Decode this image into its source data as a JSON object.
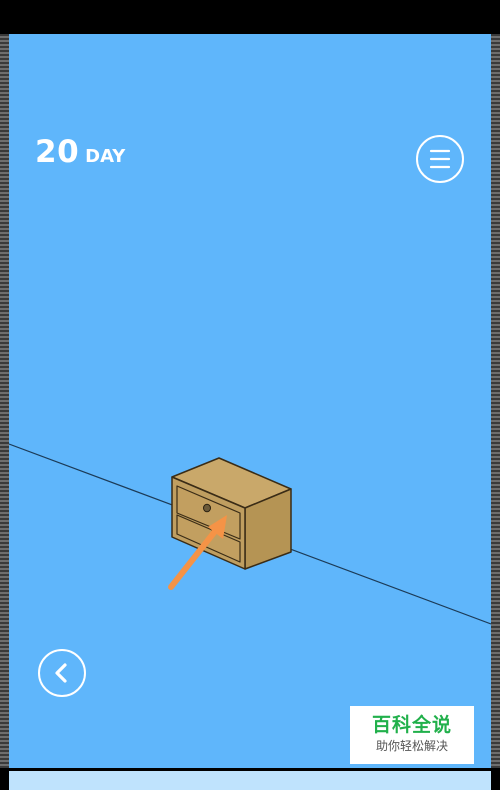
{
  "status_bar": {
    "background": "#000000"
  },
  "game": {
    "background_color": "#5fb6fb",
    "day_counter": {
      "number": "20",
      "unit": "DAY"
    },
    "menu_button": {
      "icon": "hamburger-icon"
    },
    "back_button": {
      "icon": "chevron-left-icon"
    },
    "scene": {
      "object": "cabinet-with-drawers",
      "object_color": "#c19f62",
      "hint_arrow_color": "#f59346",
      "hint_target": "drawer-knob"
    }
  },
  "watermark": {
    "title": "百科全说",
    "subtitle": "助你轻松解决",
    "title_color": "#21b04b"
  }
}
